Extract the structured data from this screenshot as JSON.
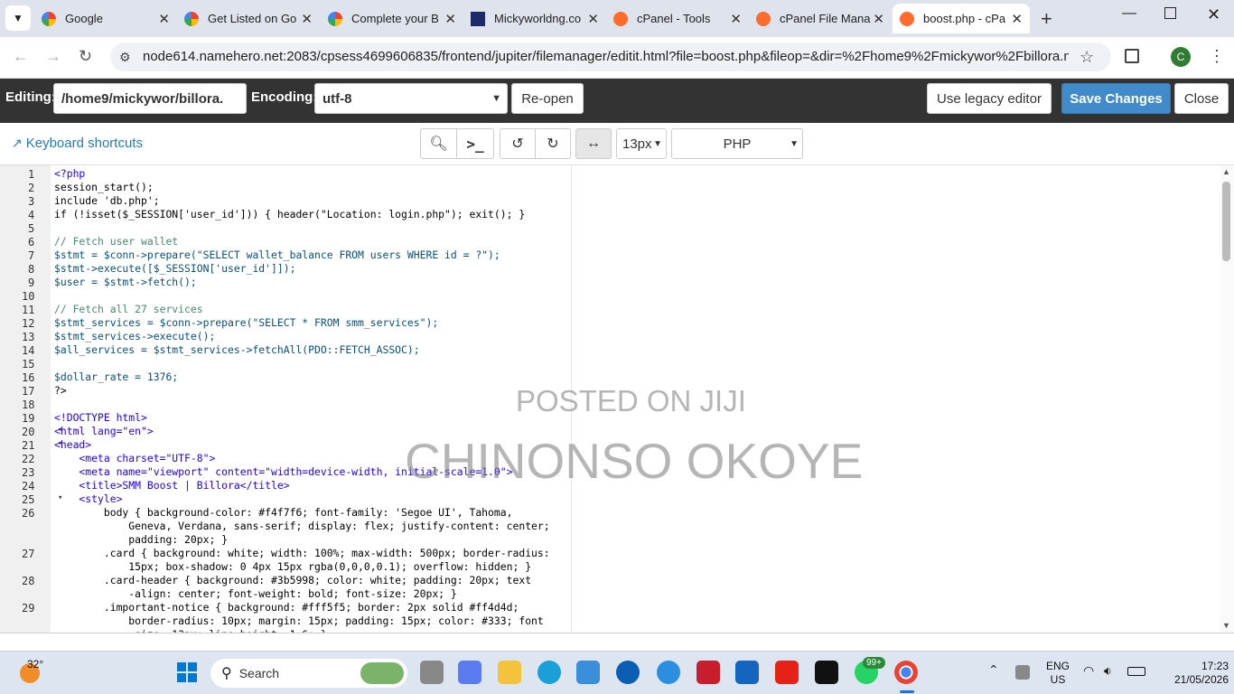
{
  "browser": {
    "tabs": [
      {
        "title": "Google",
        "icon": "google-icon",
        "active": false
      },
      {
        "title": "Get Listed on Go",
        "icon": "google-icon",
        "active": false
      },
      {
        "title": "Complete your B",
        "icon": "google-icon",
        "active": false
      },
      {
        "title": "Mickyworldng.co",
        "icon": "site-icon",
        "active": false
      },
      {
        "title": "cPanel - Tools",
        "icon": "cpanel-icon",
        "active": false
      },
      {
        "title": "cPanel File Mana",
        "icon": "cpanel-icon",
        "active": false
      },
      {
        "title": "boost.php - cPa",
        "icon": "cpanel-icon",
        "active": true
      }
    ],
    "url": "node614.namehero.net:2083/cpsess4699606835/frontend/jupiter/filemanager/editit.html?file=boost.php&fileop=&dir=%2Fhome9%2Fmickywor%2Fbillora.ng&diro...",
    "profile_initial": "C"
  },
  "editor_bar": {
    "editing_label": "Editing:",
    "path": "/home9/mickywor/billora.",
    "encoding_label": "Encoding:",
    "encoding": "utf-8",
    "reopen": "Re-open",
    "legacy": "Use legacy editor",
    "save": "Save Changes",
    "close": "Close"
  },
  "toolbar": {
    "shortcuts": "Keyboard shortcuts",
    "font_size": "13px",
    "mode": "PHP"
  },
  "code_lines": [
    {
      "n": "1",
      "t": "<?php"
    },
    {
      "n": "2",
      "t": "session_start();"
    },
    {
      "n": "3",
      "t": "include 'db.php';"
    },
    {
      "n": "4",
      "t": "if (!isset($_SESSION['user_id'])) { header(\"Location: login.php\"); exit(); }"
    },
    {
      "n": "5",
      "t": ""
    },
    {
      "n": "6",
      "t": "// Fetch user wallet"
    },
    {
      "n": "7",
      "t": "$stmt = $conn->prepare(\"SELECT wallet_balance FROM users WHERE id = ?\");"
    },
    {
      "n": "8",
      "t": "$stmt->execute([$_SESSION['user_id']]);"
    },
    {
      "n": "9",
      "t": "$user = $stmt->fetch();"
    },
    {
      "n": "10",
      "t": ""
    },
    {
      "n": "11",
      "t": "// Fetch all 27 services"
    },
    {
      "n": "12",
      "t": "$stmt_services = $conn->prepare(\"SELECT * FROM smm_services\");"
    },
    {
      "n": "13",
      "t": "$stmt_services->execute();"
    },
    {
      "n": "14",
      "t": "$all_services = $stmt_services->fetchAll(PDO::FETCH_ASSOC);"
    },
    {
      "n": "15",
      "t": ""
    },
    {
      "n": "16",
      "t": "$dollar_rate = 1376;"
    },
    {
      "n": "17",
      "t": "?>"
    },
    {
      "n": "18",
      "t": ""
    },
    {
      "n": "19",
      "t": "<!DOCTYPE html>"
    },
    {
      "n": "20",
      "t": "<html lang=\"en\">"
    },
    {
      "n": "21",
      "t": "<head>"
    },
    {
      "n": "22",
      "t": "    <meta charset=\"UTF-8\">"
    },
    {
      "n": "23",
      "t": "    <meta name=\"viewport\" content=\"width=device-width, initial-scale=1.0\">"
    },
    {
      "n": "24",
      "t": "    <title>SMM Boost | Billora</title>"
    },
    {
      "n": "25",
      "t": "    <style>"
    },
    {
      "n": "26",
      "t": "        body { background-color: #f4f7f6; font-family: 'Segoe UI', Tahoma,"
    },
    {
      "n": "",
      "t": "            Geneva, Verdana, sans-serif; display: flex; justify-content: center;"
    },
    {
      "n": "",
      "t": "            padding: 20px; }"
    },
    {
      "n": "27",
      "t": "        .card { background: white; width: 100%; max-width: 500px; border-radius:"
    },
    {
      "n": "",
      "t": "            15px; box-shadow: 0 4px 15px rgba(0,0,0,0.1); overflow: hidden; }"
    },
    {
      "n": "28",
      "t": "        .card-header { background: #3b5998; color: white; padding: 20px; text"
    },
    {
      "n": "",
      "t": "            -align: center; font-weight: bold; font-size: 20px; }"
    },
    {
      "n": "29",
      "t": "        .important-notice { background: #fff5f5; border: 2px solid #ff4d4d;"
    },
    {
      "n": "",
      "t": "            border-radius: 10px; margin: 15px; padding: 15px; color: #333; font"
    },
    {
      "n": "",
      "t": "            -size: 13px; line-height: 1.6; }"
    }
  ],
  "watermark": {
    "line1": "POSTED ON JIJI",
    "line2": "CHINONSO OKOYE"
  },
  "taskbar": {
    "weather": "32°",
    "search": "Search",
    "badge": "99+",
    "lang1": "ENG",
    "lang2": "US",
    "time": "17:23",
    "date": "21/05/2026"
  }
}
